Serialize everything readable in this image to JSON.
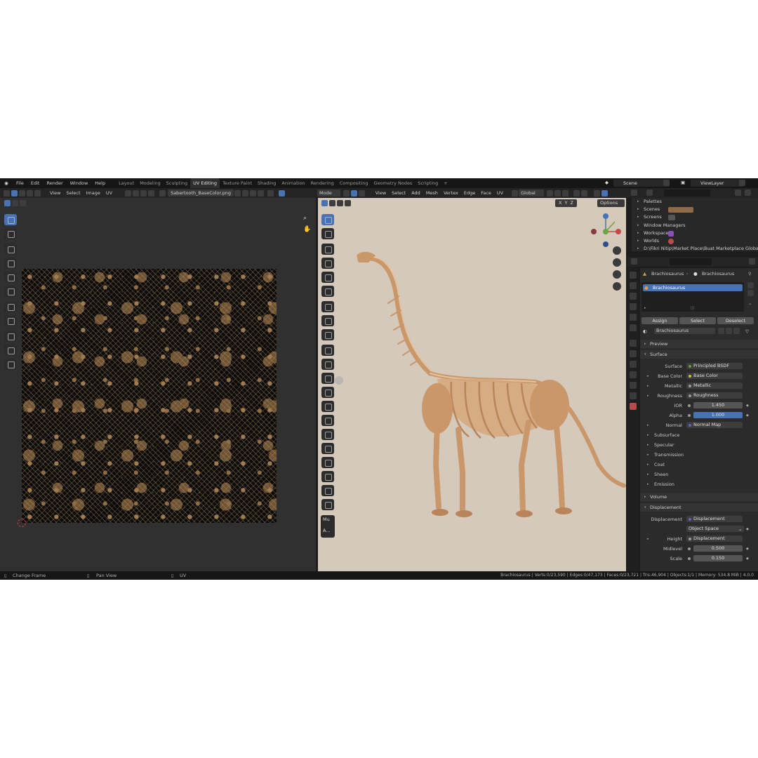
{
  "topbar": {
    "menus": [
      "File",
      "Edit",
      "Render",
      "Window",
      "Help"
    ],
    "workspaces": [
      "Layout",
      "Modeling",
      "Sculpting",
      "UV Editing",
      "Texture Paint",
      "Shading",
      "Animation",
      "Rendering",
      "Compositing",
      "Geometry Nodes",
      "Scripting"
    ],
    "active_workspace": "UV Editing",
    "add_tab": "+",
    "scene": "Scene",
    "view_layer": "ViewLayer"
  },
  "uv_editor": {
    "menus": [
      "View",
      "Select",
      "Image",
      "UV"
    ],
    "image_name": "Sabertooth_BaseColor.png"
  },
  "viewport": {
    "mode": "Mode",
    "menus": [
      "View",
      "Select",
      "Add",
      "Mesh",
      "Vertex",
      "Edge",
      "Face",
      "UV"
    ],
    "transform_orientation": "Global",
    "axes": [
      "X",
      "Y",
      "Z"
    ],
    "options": "Options",
    "side_labels": [
      "Mu",
      "A..."
    ]
  },
  "outliner": {
    "items": [
      "Palettes",
      "Scenes",
      "Screens",
      "Window Managers",
      "Workspaces",
      "Worlds"
    ],
    "path": "D:\\Fikri Nitip\\Market Place\\Buat Marketplace Global\\Re"
  },
  "properties": {
    "breadcrumb_object": "Brachiosaurus",
    "breadcrumb_material": "Brachiosaurus",
    "slot_name": "Brachiosaurus",
    "slot_buttons": [
      "Assign",
      "Select",
      "Deselect"
    ],
    "material_name": "Brachiosaurus",
    "sections": {
      "preview": "Preview",
      "surface": "Surface",
      "volume": "Volume",
      "displacement": "Displacement"
    },
    "surface_rows": [
      {
        "label": "Surface",
        "value": "Principled BSDF"
      },
      {
        "label": "Base Color",
        "value": "Base Color"
      },
      {
        "label": "Metallic",
        "value": "Metallic"
      },
      {
        "label": "Roughness",
        "value": "Roughness"
      },
      {
        "label": "IOR",
        "value": "1.450"
      },
      {
        "label": "Alpha",
        "value": "1.000"
      },
      {
        "label": "Normal",
        "value": "Normal Map"
      }
    ],
    "sub_panels": [
      "Subsurface",
      "Specular",
      "Transmission",
      "Coat",
      "Sheen",
      "Emission"
    ],
    "displacement_rows": [
      {
        "label": "Displacement",
        "value": "Displacement"
      },
      {
        "label": "",
        "value": "Object Space"
      },
      {
        "label": "Height",
        "value": "Displacement"
      },
      {
        "label": "Midlevel",
        "value": "0.500"
      },
      {
        "label": "Scale",
        "value": "0.150"
      }
    ]
  },
  "statusbar": {
    "left": "Change Frame",
    "middle": "Pan View",
    "right_hint": "UV",
    "stats": "Brachiosaurus | Verts:0/23,590 | Edges:0/47,173 | Faces:0/23,721 | Tris:46,904 | Objects:1/1 | Memory: 534.8 MiB | 4.0.0"
  },
  "colors": {
    "accent": "#4772b3",
    "background": "#1d1d1d",
    "viewport_bg": "#d4c9bb",
    "bone": "#c9976a"
  }
}
